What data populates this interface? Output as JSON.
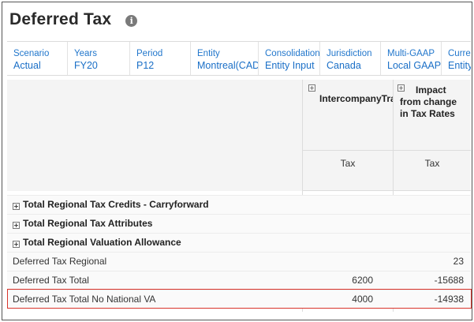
{
  "page": {
    "title": "Deferred Tax",
    "info_icon": "i"
  },
  "pov": [
    {
      "dimension": "Scenario",
      "member": "Actual"
    },
    {
      "dimension": "Years",
      "member": "FY20"
    },
    {
      "dimension": "Period",
      "member": "P12"
    },
    {
      "dimension": "Entity",
      "member": "Montreal(CAD)"
    },
    {
      "dimension": "Consolidation",
      "member": "Entity Input"
    },
    {
      "dimension": "Jurisdiction",
      "member": "Canada"
    },
    {
      "dimension": "Multi-GAAP",
      "member": "Local GAAP"
    },
    {
      "dimension": "Curren",
      "member": "Entity"
    }
  ],
  "columns": [
    {
      "title": "IntercompanyTra",
      "sub": "Tax"
    },
    {
      "title_lines": [
        "Impact",
        "from change",
        "in Tax Rates"
      ],
      "sub": "Tax"
    }
  ],
  "rows": [
    {
      "label": "Total Regional Tax Credits - Carryforward",
      "bold": true,
      "expandable": true,
      "c1": "",
      "c2": ""
    },
    {
      "label": "Total Regional Tax Attributes",
      "bold": true,
      "expandable": true,
      "c1": "",
      "c2": ""
    },
    {
      "label": "Total Regional Valuation Allowance",
      "bold": true,
      "expandable": true,
      "c1": "",
      "c2": ""
    },
    {
      "label": "Deferred Tax Regional",
      "bold": false,
      "expandable": false,
      "c1": "",
      "c2": "23"
    },
    {
      "label": "Deferred Tax Total",
      "bold": false,
      "expandable": false,
      "c1": "6200",
      "c2": "-15688"
    },
    {
      "label": "Deferred Tax Total No National VA",
      "bold": false,
      "expandable": false,
      "c1": "4000",
      "c2": "-14938"
    }
  ],
  "colors": {
    "pov_link": "#1a6fc7",
    "highlight": "#d9342b",
    "header_bg": "#f4f4f4"
  }
}
